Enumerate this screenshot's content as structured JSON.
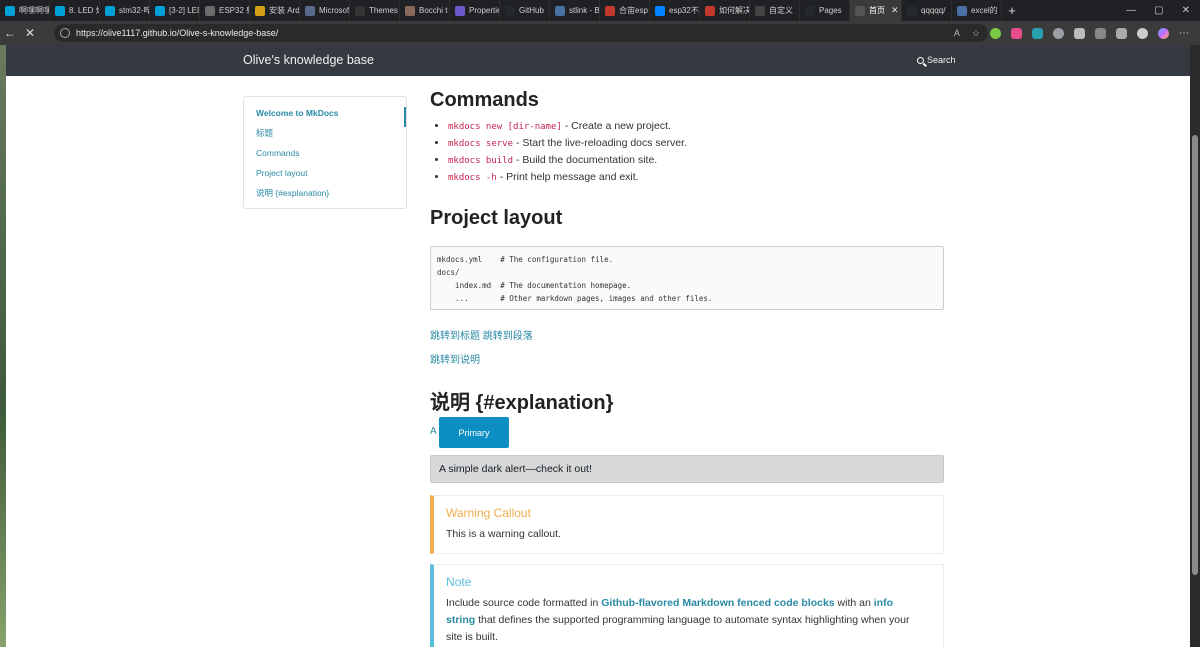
{
  "browser": {
    "tabs": [
      {
        "label": "啊嘿啊嘿",
        "icon_color": "#00a1d6"
      },
      {
        "label": "8. LED 灯",
        "icon_color": "#00a1d6"
      },
      {
        "label": "stm32-哔",
        "icon_color": "#00a1d6"
      },
      {
        "label": "[3-2] LED",
        "icon_color": "#00a1d6"
      },
      {
        "label": "ESP32 射",
        "icon_color": "#6b6b6b"
      },
      {
        "label": "安装 Ard",
        "icon_color": "#d4a017"
      },
      {
        "label": "Microsof",
        "icon_color": "#5a6a8a"
      },
      {
        "label": "Themes",
        "icon_color": "#333333"
      },
      {
        "label": "Bocchi t",
        "icon_color": "#8a6a5a"
      },
      {
        "label": "Propertie",
        "icon_color": "#6a5acd"
      },
      {
        "label": "GitHub",
        "icon_color": "#24292e"
      },
      {
        "label": "stlink - B",
        "icon_color": "#4a6fa5"
      },
      {
        "label": "合宙esp",
        "icon_color": "#c0392b"
      },
      {
        "label": "esp32不",
        "icon_color": "#0084ff"
      },
      {
        "label": "如何解决",
        "icon_color": "#c0392b"
      },
      {
        "label": "自定义",
        "icon_color": "#444444"
      },
      {
        "label": "Pages",
        "icon_color": "#24292e"
      },
      {
        "label": "首页",
        "icon_color": "#555555"
      },
      {
        "label": "qqqqq/",
        "icon_color": "#24292e"
      },
      {
        "label": "excel的",
        "icon_color": "#4a6fa5"
      }
    ],
    "active_tab_index": 17,
    "url": "https://olive1117.github.io/Olive-s-knowledge-base/"
  },
  "site": {
    "brand": "Olive's knowledge base",
    "search_label": "Search"
  },
  "toc": [
    "Welcome to MkDocs",
    "标题",
    "Commands",
    "Project layout",
    "说明 {#explanation}"
  ],
  "commands": {
    "heading": "Commands",
    "items": [
      {
        "code": "mkdocs new [dir-name]",
        "desc": " - Create a new project."
      },
      {
        "code": "mkdocs serve",
        "desc": " - Start the live-reloading docs server."
      },
      {
        "code": "mkdocs build",
        "desc": " - Build the documentation site."
      },
      {
        "code": "mkdocs -h",
        "desc": " - Print help message and exit."
      }
    ]
  },
  "layout": {
    "heading": "Project layout",
    "code": "mkdocs.yml    # The configuration file.\ndocs/\n    index.md  # The documentation homepage.\n    ...       # Other markdown pages, images and other files."
  },
  "links": {
    "jump1": "跳转到标题 跳转到段落",
    "jump2": "跳转到说明"
  },
  "explanation": {
    "heading": "说明 {#explanation}",
    "a_text": "A",
    "button_label": "Primary",
    "alert_text": "A simple dark alert—check it out!"
  },
  "warning": {
    "title": "Warning Callout",
    "body": "This is a warning callout."
  },
  "note": {
    "title": "Note",
    "body_pre": "Include source code formatted in ",
    "link1": "Github-flavored Markdown fenced code blocks",
    "body_mid": " with an ",
    "link2": "info string",
    "body_post": " that defines the supported programming language to automate syntax highlighting when your site is built."
  },
  "colors": {
    "accent": "#2a8aa5",
    "primary_button": "#0d8ec2",
    "warning": "#f0ad4e",
    "info": "#5bc0de",
    "navbar": "#343a40"
  }
}
